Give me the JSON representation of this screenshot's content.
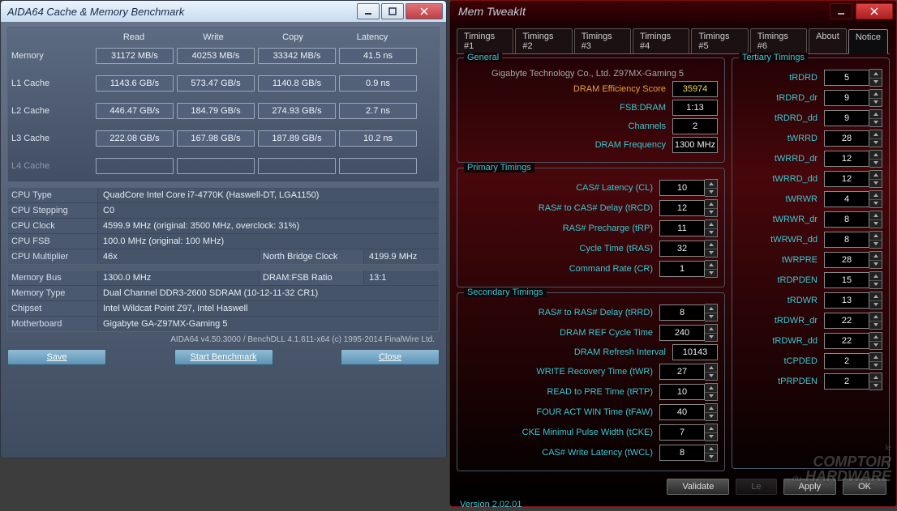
{
  "aida": {
    "title": "AIDA64 Cache & Memory Benchmark",
    "cols": {
      "read": "Read",
      "write": "Write",
      "copy": "Copy",
      "lat": "Latency"
    },
    "rows": {
      "memory": {
        "lbl": "Memory",
        "read": "31172 MB/s",
        "write": "40253 MB/s",
        "copy": "33342 MB/s",
        "lat": "41.5 ns"
      },
      "l1": {
        "lbl": "L1 Cache",
        "read": "1143.6 GB/s",
        "write": "573.47 GB/s",
        "copy": "1140.8 GB/s",
        "lat": "0.9 ns"
      },
      "l2": {
        "lbl": "L2 Cache",
        "read": "446.47 GB/s",
        "write": "184.79 GB/s",
        "copy": "274.93 GB/s",
        "lat": "2.7 ns"
      },
      "l3": {
        "lbl": "L3 Cache",
        "read": "222.08 GB/s",
        "write": "167.98 GB/s",
        "copy": "187.89 GB/s",
        "lat": "10.2 ns"
      },
      "l4": {
        "lbl": "L4 Cache"
      }
    },
    "info": {
      "cpu_type": {
        "k": "CPU Type",
        "v": "QuadCore Intel Core i7-4770K (Haswell-DT, LGA1150)"
      },
      "cpu_step": {
        "k": "CPU Stepping",
        "v": "C0"
      },
      "cpu_clock": {
        "k": "CPU Clock",
        "v": "4599.9 MHz  (original: 3500 MHz, overclock: 31%)"
      },
      "cpu_fsb": {
        "k": "CPU FSB",
        "v": "100.0 MHz  (original: 100 MHz)"
      },
      "cpu_mul": {
        "k": "CPU Multiplier",
        "v": "46x",
        "k2": "North Bridge Clock",
        "v2": "4199.9 MHz"
      },
      "mem_bus": {
        "k": "Memory Bus",
        "v": "1300.0 MHz",
        "k2": "DRAM:FSB Ratio",
        "v2": "13:1"
      },
      "mem_type": {
        "k": "Memory Type",
        "v": "Dual Channel DDR3-2600 SDRAM  (10-12-11-32 CR1)"
      },
      "chipset": {
        "k": "Chipset",
        "v": "Intel Wildcat Point Z97, Intel Haswell"
      },
      "mobo": {
        "k": "Motherboard",
        "v": "Gigabyte GA-Z97MX-Gaming 5"
      }
    },
    "footer": "AIDA64 v4.50.3000 / BenchDLL 4.1.611-x64   (c) 1995-2014 FinalWire Ltd.",
    "btn_save": "Save",
    "btn_start": "Start Benchmark",
    "btn_close": "Close"
  },
  "mtw": {
    "title": "Mem TweakIt",
    "tabs": [
      "Timings #1",
      "Timings #2",
      "Timings #3",
      "Timings #4",
      "Timings #5",
      "Timings #6",
      "About",
      "Notice"
    ],
    "tab_active": 7,
    "general": {
      "title": "General",
      "board": "Gigabyte Technology Co., Ltd. Z97MX-Gaming 5",
      "eff_k": "DRAM Efficiency Score",
      "eff_v": "35974",
      "fsb_k": "FSB:DRAM",
      "fsb_v": "1:13",
      "ch_k": "Channels",
      "ch_v": "2",
      "freq_k": "DRAM Frequency",
      "freq_v": "1300 MHz"
    },
    "primary": {
      "title": "Primary Timings",
      "cl": {
        "k": "CAS# Latency (CL)",
        "v": "10"
      },
      "trcd": {
        "k": "RAS# to CAS# Delay (tRCD)",
        "v": "12"
      },
      "trp": {
        "k": "RAS# Precharge (tRP)",
        "v": "11"
      },
      "tras": {
        "k": "Cycle Time (tRAS)",
        "v": "32"
      },
      "cr": {
        "k": "Command Rate (CR)",
        "v": "1"
      }
    },
    "secondary": {
      "title": "Secondary Timings",
      "trrd": {
        "k": "RAS# to RAS# Delay (tRRD)",
        "v": "8"
      },
      "tref": {
        "k": "DRAM REF Cycle Time",
        "v": "240"
      },
      "trefi": {
        "k": "DRAM Refresh Interval",
        "v": "10143"
      },
      "twr": {
        "k": "WRITE Recovery Time (tWR)",
        "v": "27"
      },
      "trtp": {
        "k": "READ to PRE Time (tRTP)",
        "v": "10"
      },
      "tfaw": {
        "k": "FOUR ACT WIN Time (tFAW)",
        "v": "40"
      },
      "tcke": {
        "k": "CKE Minimul Pulse Width (tCKE)",
        "v": "7"
      },
      "twcl": {
        "k": "CAS# Write Latency (tWCL)",
        "v": "8"
      }
    },
    "tertiary": {
      "title": "Tertiary Timings",
      "items": [
        {
          "k": "tRDRD",
          "v": "5"
        },
        {
          "k": "tRDRD_dr",
          "v": "9"
        },
        {
          "k": "tRDRD_dd",
          "v": "9"
        },
        {
          "k": "tWRRD",
          "v": "28"
        },
        {
          "k": "tWRRD_dr",
          "v": "12"
        },
        {
          "k": "tWRRD_dd",
          "v": "12"
        },
        {
          "k": "tWRWR",
          "v": "4"
        },
        {
          "k": "tWRWR_dr",
          "v": "8"
        },
        {
          "k": "tWRWR_dd",
          "v": "8"
        },
        {
          "k": "tWRPRE",
          "v": "28"
        },
        {
          "k": "tRDPDEN",
          "v": "15"
        },
        {
          "k": "tRDWR",
          "v": "13"
        },
        {
          "k": "tRDWR_dr",
          "v": "22"
        },
        {
          "k": "tRDWR_dd",
          "v": "22"
        },
        {
          "k": "tCPDED",
          "v": "2"
        },
        {
          "k": "tPRPDEN",
          "v": "2"
        }
      ]
    },
    "btn_validate": "Validate",
    "btn_le": "Le",
    "btn_apply": "Apply",
    "btn_ok": "OK",
    "version": "Version 2.02.01",
    "watermark_small": "le",
    "watermark1": "COMPTOIR",
    "watermark_du": "du",
    "watermark2": "HARDWARE"
  }
}
